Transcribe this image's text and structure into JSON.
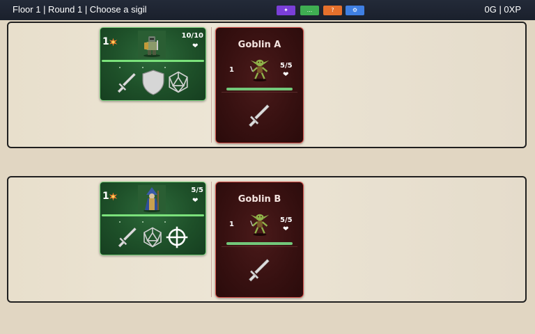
{
  "topbar": {
    "status": "Floor 1 | Round 1 | Choose a sigil",
    "resources": "0G | 0XP",
    "buttons": [
      {
        "label": "✦",
        "color": "#7a3fd8",
        "icon": "sparkle-icon"
      },
      {
        "label": "...",
        "color": "#3fae52",
        "icon": "more-icon"
      },
      {
        "label": "?",
        "color": "#e5702c",
        "icon": "help-icon"
      },
      {
        "label": "⚙",
        "color": "#3f7fe2",
        "icon": "gear-icon"
      }
    ]
  },
  "lanes": [
    {
      "hero": {
        "attack": "1",
        "hp": "10/10",
        "portrait": "knight-portrait",
        "sigils": [
          "sword-icon",
          "shield-icon",
          "d20-icon"
        ]
      },
      "enemy": {
        "name": "Goblin A",
        "attack": "1",
        "hp": "5/5",
        "portrait": "goblin-portrait",
        "sigils": [
          "sword-icon"
        ]
      }
    },
    {
      "hero": {
        "attack": "1",
        "hp": "5/5",
        "portrait": "wizard-portrait",
        "sigils": [
          "sword-icon",
          "d20-icon",
          "crosshair-icon"
        ]
      },
      "enemy": {
        "name": "Goblin B",
        "attack": "1",
        "hp": "5/5",
        "portrait": "goblin-portrait",
        "sigils": [
          "sword-icon"
        ]
      }
    }
  ],
  "colors": {
    "background": "#e1d6c2",
    "hero_card": "#1e5029",
    "enemy_card": "#361010",
    "hp_bar": "#7be27b"
  }
}
